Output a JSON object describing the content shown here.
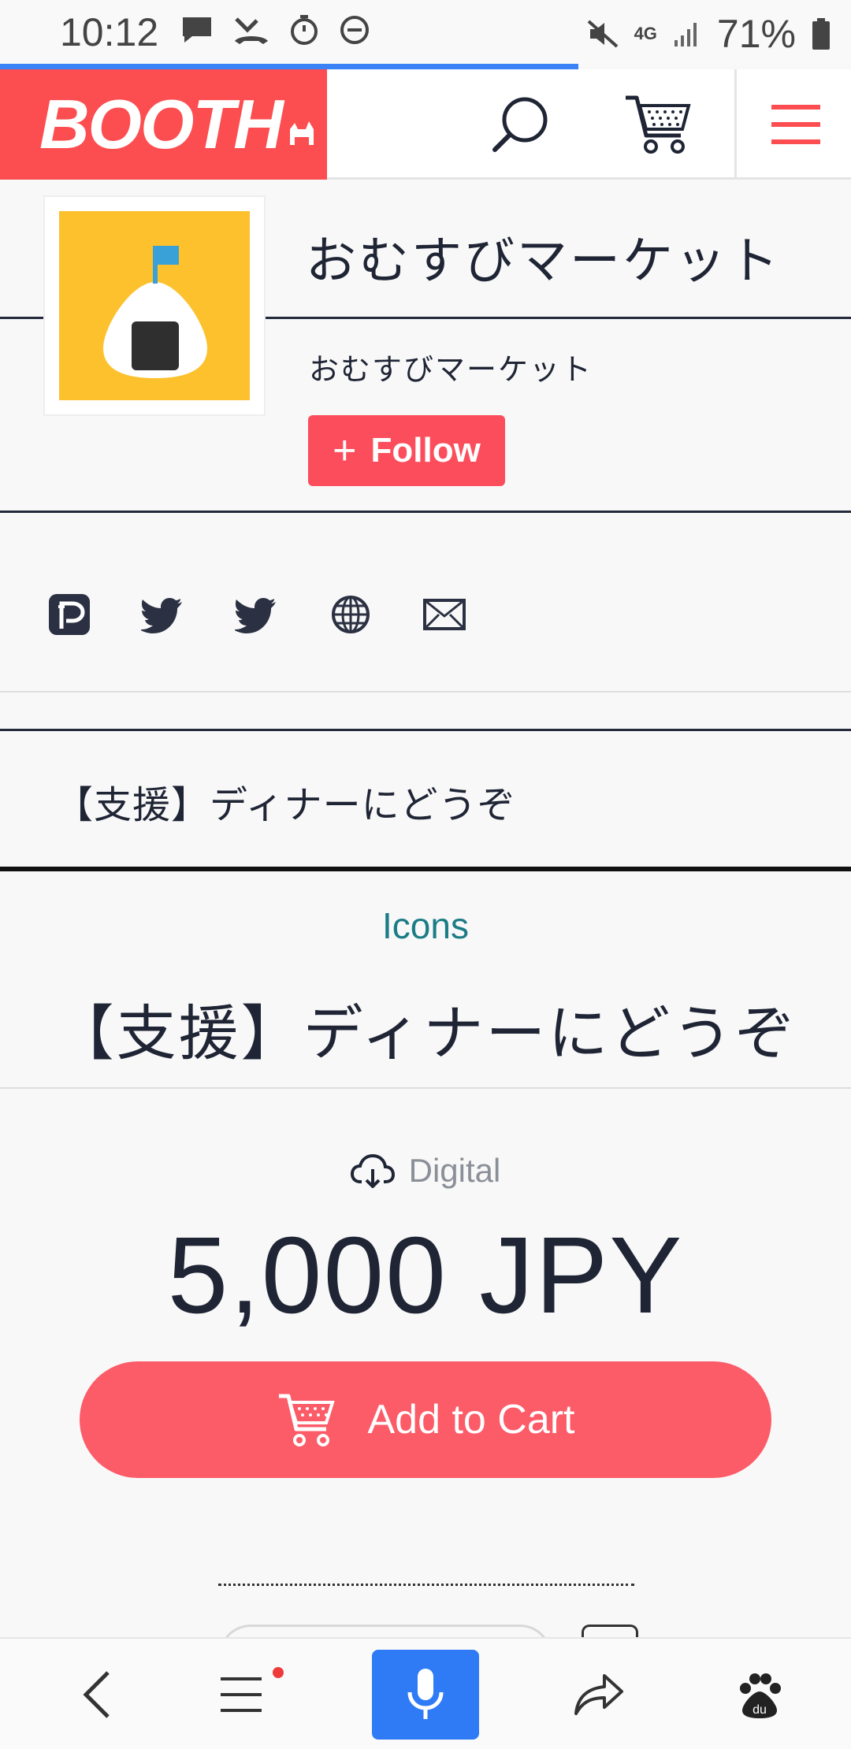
{
  "status_bar": {
    "time": "10:12",
    "battery_pct": "71%",
    "network": "4G"
  },
  "page_load_progress": 0.68,
  "header": {
    "logo": "BOOTH"
  },
  "shop": {
    "name": "おむすびマーケット",
    "subtitle": "おむすびマーケット",
    "follow_label": "Follow",
    "follow_icon": "+"
  },
  "social_links": [
    "pixiv-icon",
    "twitter-icon",
    "twitter-icon",
    "globe-icon",
    "mail-icon"
  ],
  "breadcrumb_item": "【支援】ディナーにどうぞ",
  "item": {
    "category": "Icons",
    "title": "【支援】ディナーにどうぞ",
    "type": "Digital",
    "price": "5,000 JPY",
    "add_to_cart": "Add to Cart"
  },
  "colors": {
    "brand": "#fc4d50",
    "button": "#fc5b68",
    "link": "#1c7c86",
    "mic": "#2f7bf5"
  }
}
